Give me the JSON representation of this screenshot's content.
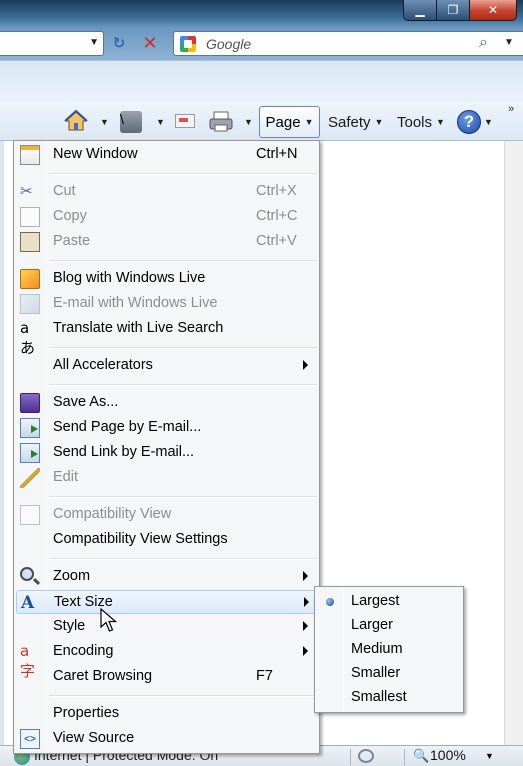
{
  "window": {
    "controls": {
      "minimize": "▁",
      "maximize": "❐",
      "close": "✕"
    }
  },
  "navbar": {
    "search_placeholder": "Google",
    "address_dropdown": "▼",
    "refresh_icon": "↻",
    "stop_icon": "✕",
    "search_icon": "⌕",
    "search_dropdown": "▼"
  },
  "commandbar": {
    "page_label": "Page",
    "safety_label": "Safety",
    "tools_label": "Tools",
    "help_label": "?",
    "more_label": "»",
    "caret": "▼"
  },
  "page_menu": {
    "items": [
      {
        "label": "New Window",
        "shortcut": "Ctrl+N"
      },
      {
        "label": "Cut",
        "shortcut": "Ctrl+X"
      },
      {
        "label": "Copy",
        "shortcut": "Ctrl+C"
      },
      {
        "label": "Paste",
        "shortcut": "Ctrl+V"
      },
      {
        "label": "Blog with Windows Live"
      },
      {
        "label": "E-mail with Windows Live"
      },
      {
        "label": "Translate with Live Search"
      },
      {
        "label": "All Accelerators"
      },
      {
        "label": "Save As..."
      },
      {
        "label": "Send Page by E-mail..."
      },
      {
        "label": "Send Link by E-mail..."
      },
      {
        "label": "Edit"
      },
      {
        "label": "Compatibility View"
      },
      {
        "label": "Compatibility View Settings"
      },
      {
        "label": "Zoom"
      },
      {
        "label": "Text Size"
      },
      {
        "label": "Style"
      },
      {
        "label": "Encoding"
      },
      {
        "label": "Caret Browsing",
        "shortcut": "F7"
      },
      {
        "label": "Properties"
      },
      {
        "label": "View Source"
      }
    ]
  },
  "text_size_submenu": {
    "items": [
      {
        "label": "Largest",
        "selected": true
      },
      {
        "label": "Larger"
      },
      {
        "label": "Medium"
      },
      {
        "label": "Smaller"
      },
      {
        "label": "Smallest"
      }
    ]
  },
  "statusbar": {
    "zone_text": "Internet | Protected Mode: On",
    "zoom_text": "100%",
    "zoom_dropdown": "▼"
  },
  "colors": {
    "accent": "#2d68b8",
    "menu_hover": "#dbeafa",
    "disabled_text": "#8d8d8d"
  }
}
